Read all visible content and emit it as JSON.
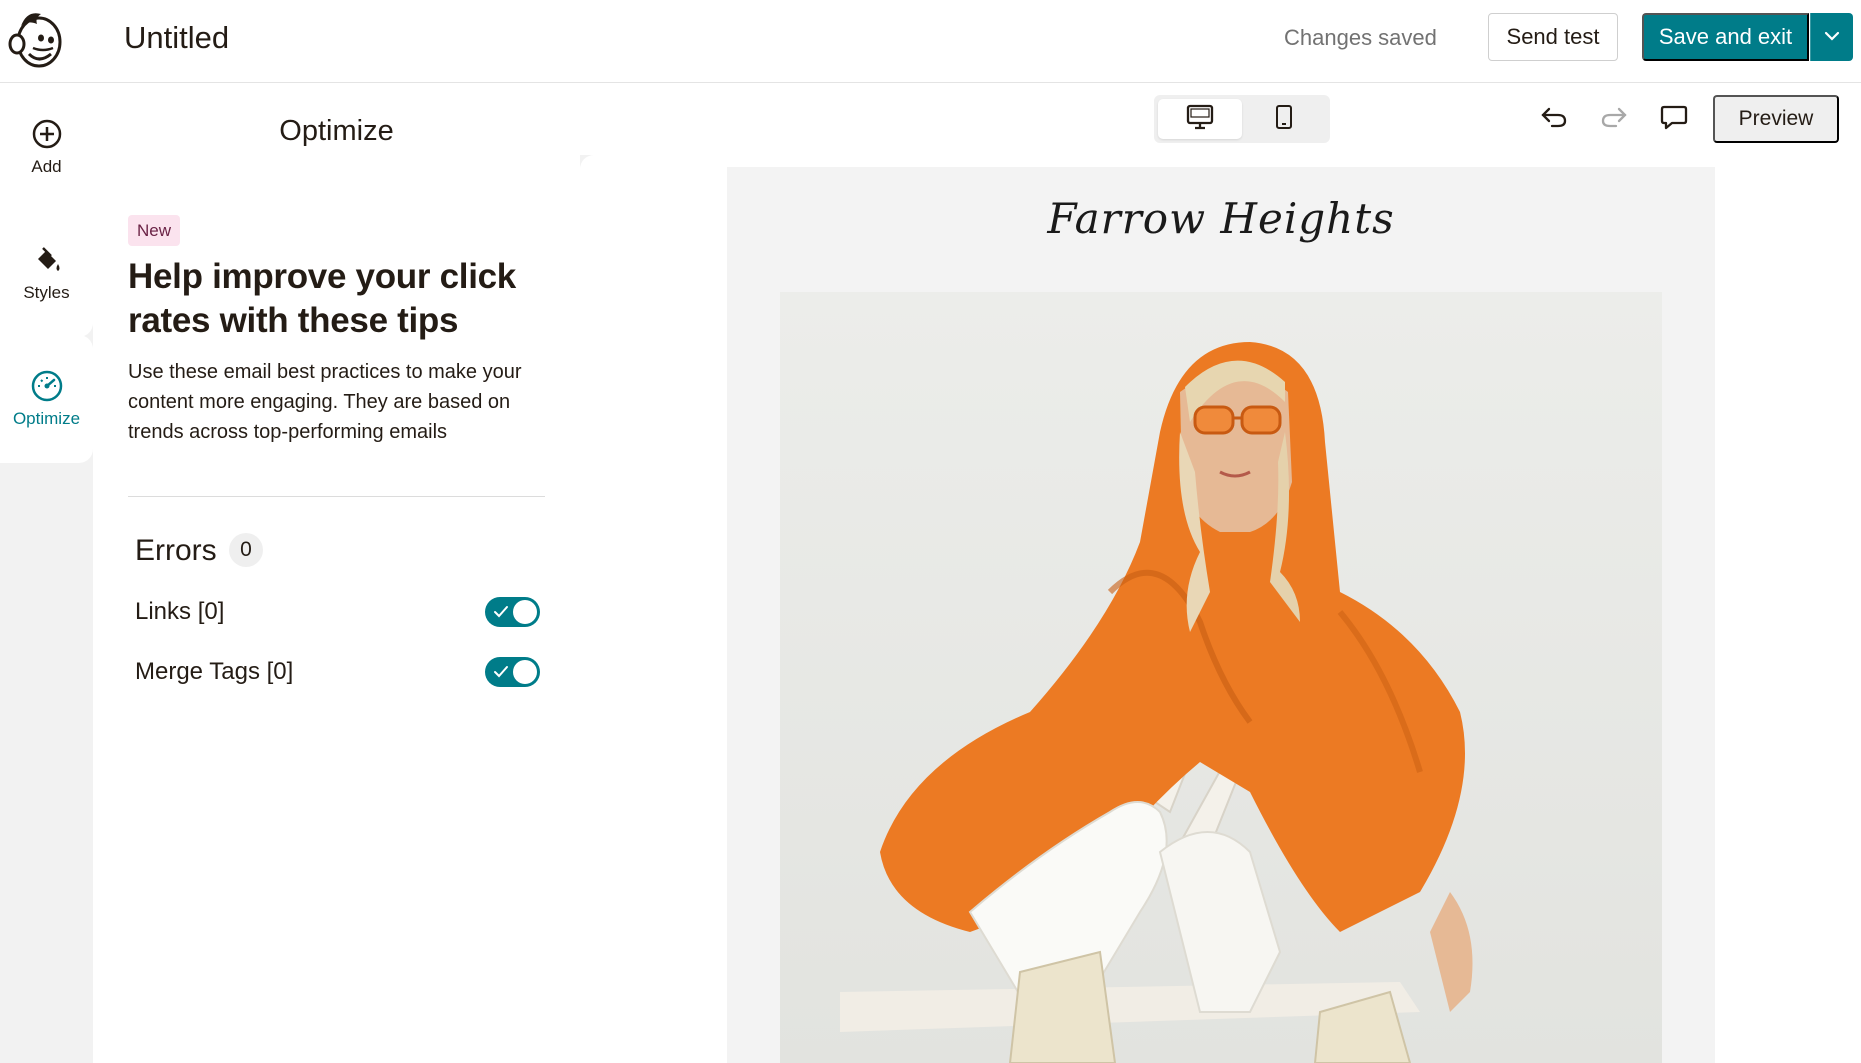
{
  "header": {
    "logo_icon": "mailchimp-freddie-icon",
    "title": "Untitled",
    "status": "Changes saved",
    "send_test_label": "Send test",
    "save_exit_label": "Save and exit",
    "save_dropdown_icon": "chevron-down-icon",
    "accent_color": "#007c89"
  },
  "rail": {
    "items": [
      {
        "label": "Add",
        "icon": "plus-circle-icon"
      },
      {
        "label": "Styles",
        "icon": "paint-bucket-icon"
      },
      {
        "label": "Optimize",
        "icon": "gauge-icon",
        "active": true
      }
    ]
  },
  "panel": {
    "title": "Optimize",
    "badge": "New",
    "heading": "Help improve your click rates with these tips",
    "description": "Use these email best practices to make your content more engaging. They are based on trends across top-performing emails",
    "errors_label": "Errors",
    "errors_count": "0",
    "checks": [
      {
        "label": "Links [0]",
        "enabled": true
      },
      {
        "label": "Merge Tags [0]",
        "enabled": true
      }
    ]
  },
  "toolbar": {
    "desktop_icon": "desktop-icon",
    "mobile_icon": "mobile-icon",
    "undo_icon": "undo-icon",
    "redo_icon": "redo-icon",
    "comment_icon": "comment-icon",
    "preview_label": "Preview"
  },
  "email": {
    "brand_name": "Farrow Heights",
    "hero_image": "hero-photo"
  }
}
